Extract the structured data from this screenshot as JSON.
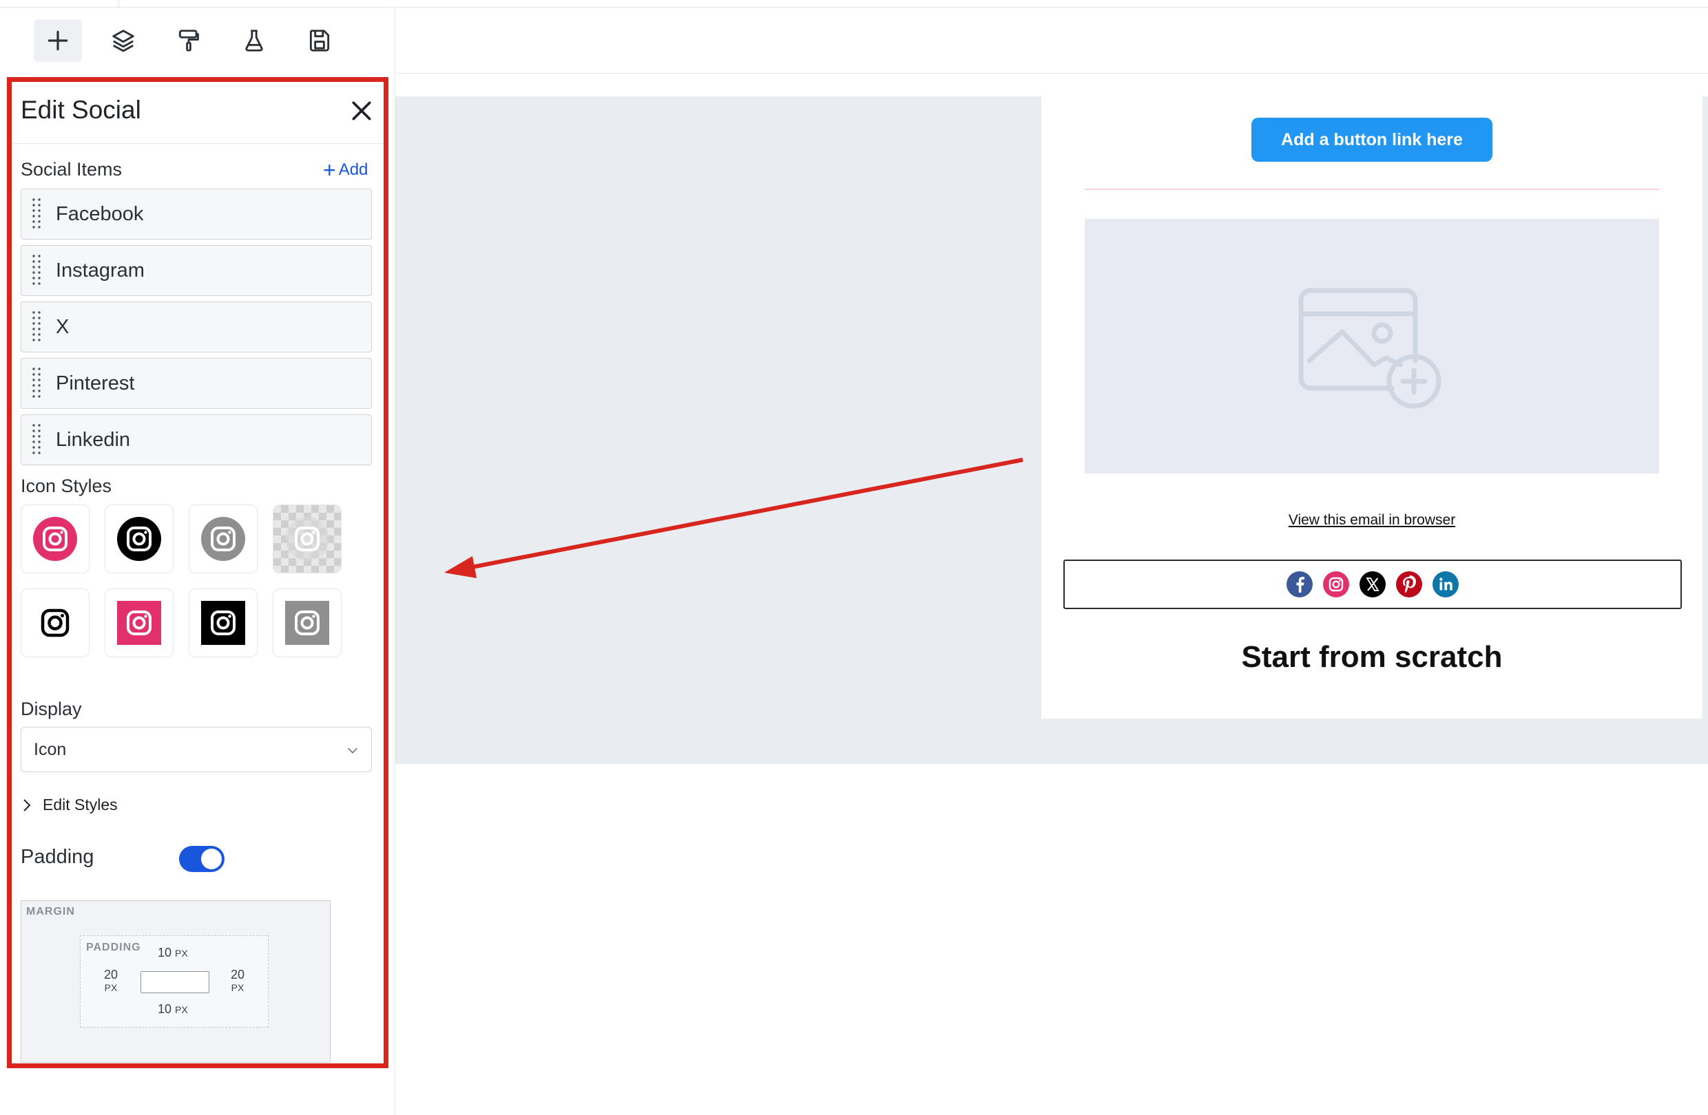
{
  "toolbar": {
    "tools": [
      {
        "icon": "plus-icon",
        "active": true
      },
      {
        "icon": "layers-icon",
        "active": false
      },
      {
        "icon": "paint-roller-icon",
        "active": false
      },
      {
        "icon": "flask-icon",
        "active": false
      },
      {
        "icon": "save-icon",
        "active": false
      }
    ]
  },
  "panel": {
    "title": "Edit Social",
    "social_items_label": "Social Items",
    "add_label": "Add",
    "items": [
      "Facebook",
      "Instagram",
      "X",
      "Pinterest",
      "Linkedin"
    ],
    "icon_styles_label": "Icon Styles",
    "display_label": "Display",
    "display_value": "Icon",
    "edit_styles_label": "Edit Styles",
    "padding_label": "Padding",
    "padding_enabled": true,
    "spacing": {
      "margin_title": "MARGIN",
      "padding_title": "PADDING",
      "top": "10",
      "bottom": "10",
      "left": "20",
      "right": "20",
      "unit": "PX"
    }
  },
  "email": {
    "button_label": "Add a button link here",
    "view_link": "View this email in browser",
    "heading": "Start from scratch",
    "social_icons": [
      "facebook-icon",
      "instagram-icon",
      "x-icon",
      "pinterest-icon",
      "linkedin-icon"
    ]
  },
  "colors": {
    "highlight": "#d8251d",
    "accent": "#1a56db",
    "button": "#2196f3",
    "instagram": "#e1306c"
  }
}
